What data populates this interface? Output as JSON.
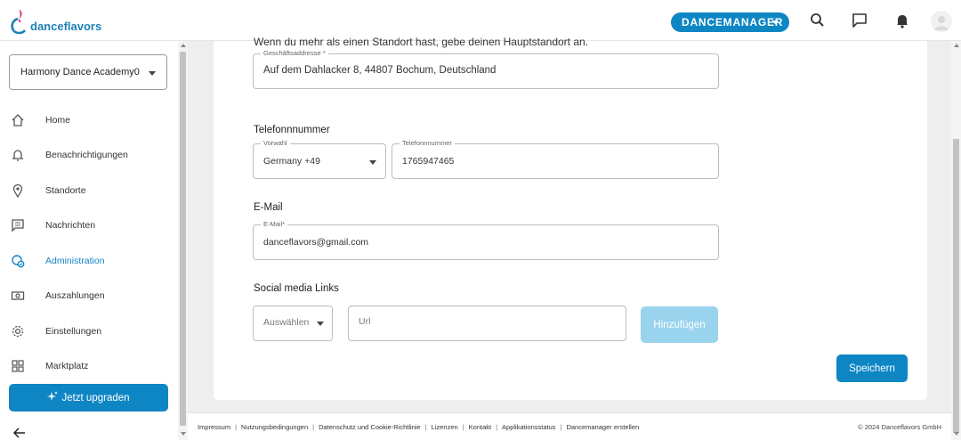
{
  "brand": {
    "name": "danceflavors",
    "accent": "#0f86c4",
    "accent_light": "#9ad3ee",
    "pink": "#d6336c"
  },
  "topbar": {
    "product_switch": "DANCEMANAGER",
    "icons": [
      "search-icon",
      "chat-icon",
      "bell-icon",
      "avatar"
    ]
  },
  "sidebar": {
    "school_select": "Harmony Dance Academy0",
    "items": [
      {
        "label": "Home",
        "icon": "home-icon"
      },
      {
        "label": "Benachrichtigungen",
        "icon": "bell-icon"
      },
      {
        "label": "Standorte",
        "icon": "location-pin-icon"
      },
      {
        "label": "Nachrichten",
        "icon": "message-icon"
      },
      {
        "label": "Administration",
        "icon": "admin-icon",
        "active": true
      },
      {
        "label": "Auszahlungen",
        "icon": "payout-icon"
      },
      {
        "label": "Einstellungen",
        "icon": "gear-icon"
      },
      {
        "label": "Marktplatz",
        "icon": "grid-icon"
      }
    ],
    "upgrade_button": "Jetzt upgraden"
  },
  "form": {
    "location_hint": "Wenn du mehr als einen Standort hast, gebe deinen Hauptstandort an.",
    "address": {
      "label": "Geschäftsaddresse *",
      "value": "Auf dem Dahlacker 8, 44807 Bochum, Deutschland"
    },
    "phone": {
      "title": "Telefonnnummer",
      "prefix_label": "Vorwahl",
      "prefix_value": "Germany +49",
      "number_label": "Telefonnnummer",
      "number_value": "1765947465"
    },
    "email": {
      "title": "E-Mail",
      "label": "E-Mail*",
      "value": "danceflavors@gmail.com"
    },
    "social": {
      "title": "Social media Links",
      "select_placeholder": "Auswählen",
      "url_placeholder": "Url",
      "add_button": "Hinzufügen"
    },
    "save_button": "Speichern"
  },
  "footer": {
    "links": [
      "Impressum",
      "Nutzungsbedingungen",
      "Datenschutz und Cookie-Richtlinie",
      "Lizenzen",
      "Kontakt",
      "Applikationsstatus",
      "Dancemanager erstellen"
    ],
    "copyright": "© 2024 Danceflavors GmbH"
  }
}
